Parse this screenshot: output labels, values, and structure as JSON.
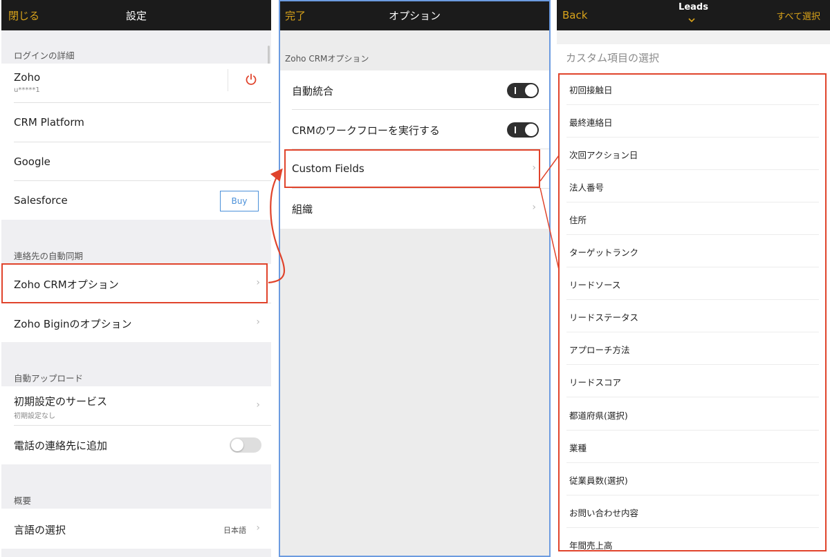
{
  "settings": {
    "nav": {
      "left": "閉じる",
      "title": "設定"
    },
    "login_section": "ログインの詳細",
    "zoho_account": {
      "label": "Zoho",
      "sub": "u*****1"
    },
    "crm_platform": "CRM Platform",
    "google": "Google",
    "salesforce": {
      "label": "Salesforce",
      "buy": "Buy"
    },
    "sync_section": "連絡先の自動同期",
    "zoho_crm_option": "Zoho CRMオプション",
    "zoho_bigin_option": "Zoho Biginのオプション",
    "upload_section": "自動アップロード",
    "default_service": {
      "label": "初期設定のサービス",
      "sub": "初期設定なし"
    },
    "add_to_phone": "電話の連絡先に追加",
    "overview_section": "概要",
    "language": {
      "label": "言語の選択",
      "value": "日本語"
    }
  },
  "options": {
    "nav": {
      "left": "完了",
      "title": "オプション"
    },
    "section": "Zoho CRMオプション",
    "auto_merge": "自動統合",
    "run_workflow": "CRMのワークフローを実行する",
    "custom_fields": "Custom Fields",
    "organization": "組織"
  },
  "leads": {
    "nav": {
      "left": "Back",
      "title": "Leads",
      "right": "すべて選択"
    },
    "section": "カスタム項目の選択",
    "fields": [
      "初回接触日",
      "最終連絡日",
      "次回アクション日",
      "法人番号",
      "住所",
      "ターゲットランク",
      "リードソース",
      "リードステータス",
      "アプローチ方法",
      "リードスコア",
      "都道府県(選択)",
      "業種",
      "従業員数(選択)",
      "お問い合わせ内容",
      "年間売上高"
    ]
  },
  "colors": {
    "accent": "#d9a31a",
    "highlight": "#e0432b",
    "frame": "#6c9be0",
    "navbar": "#1b1b1b"
  },
  "toggles": {
    "auto_merge": true,
    "run_workflow": true,
    "add_to_phone": false
  }
}
